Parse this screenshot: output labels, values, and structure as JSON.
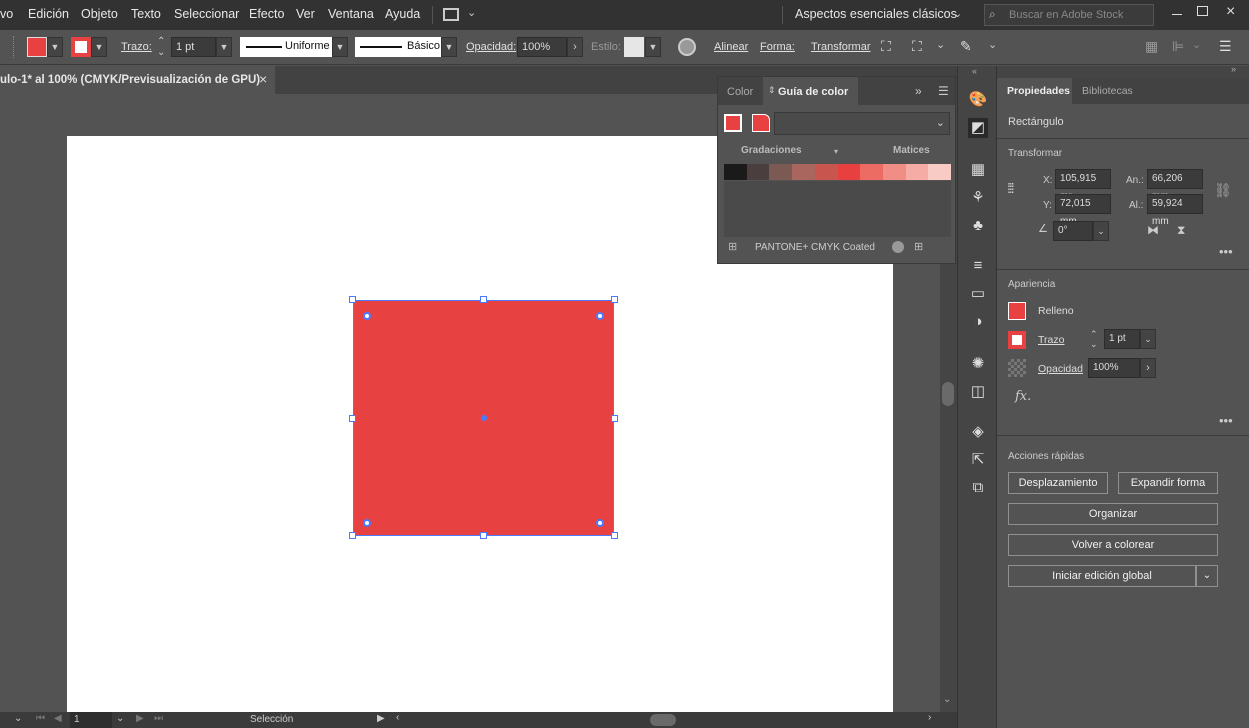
{
  "menu": {
    "items": [
      "vo",
      "Edición",
      "Objeto",
      "Texto",
      "Seleccionar",
      "Efecto",
      "Ver",
      "Ventana",
      "Ayuda"
    ],
    "workspace": "Aspectos esenciales clásicos",
    "search_placeholder": "Buscar en Adobe Stock"
  },
  "control": {
    "stroke_label": "Trazo:",
    "stroke_value": "1 pt",
    "profile": "Uniforme",
    "brush": "Básico",
    "opacity_label": "Opacidad:",
    "opacity_value": "100%",
    "style_label": "Estilo:",
    "align": "Alinear",
    "shape": "Forma:",
    "transform": "Transformar"
  },
  "doc": {
    "tab_title": "ulo-1* al 100% (CMYK/Previsualización de GPU)",
    "close": "×"
  },
  "status": {
    "zoom": "1",
    "tool": "Selección"
  },
  "color_panel": {
    "tab_color": "Color",
    "tab_guide": "Guía de color",
    "gradations": "Gradaciones",
    "tints": "Matices",
    "library": "PANTONE+ CMYK Coated",
    "swatches": [
      "#1a1a1a",
      "#4a3e3e",
      "#7a5a52",
      "#a8665e",
      "#c8564f",
      "#e8403f",
      "#ec6c64",
      "#f08e86",
      "#f4aca5",
      "#f8cbc5"
    ]
  },
  "props": {
    "tab_properties": "Propiedades",
    "tab_libraries": "Bibliotecas",
    "object_type": "Rectángulo",
    "transform_title": "Transformar",
    "x_label": "X:",
    "x_value": "105,915 mr",
    "y_label": "Y:",
    "y_value": "72,015 mm",
    "w_label": "An.:",
    "w_value": "66,206 mm",
    "h_label": "Al.:",
    "h_value": "59,924 mm",
    "angle_value": "0°",
    "appearance_title": "Apariencia",
    "fill_label": "Relleno",
    "stroke_label": "Trazo",
    "stroke_value": "1 pt",
    "opacity_label": "Opacidad",
    "opacity_value": "100%",
    "fx": "fx.",
    "quick_actions_title": "Acciones rápidas",
    "btn_offset": "Desplazamiento",
    "btn_expand": "Expandir forma",
    "btn_arrange": "Organizar",
    "btn_recolor": "Volver a colorear",
    "btn_global_edit": "Iniciar edición global"
  },
  "colors": {
    "fill": "#e84142",
    "selection": "#4a7bff"
  }
}
